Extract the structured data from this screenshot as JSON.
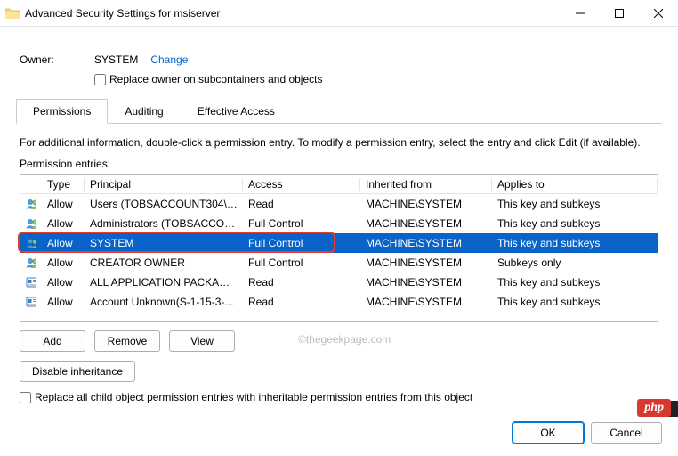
{
  "title": "Advanced Security Settings for msiserver",
  "owner": {
    "label": "Owner:",
    "value": "SYSTEM",
    "change": "Change",
    "replace_label": "Replace owner on subcontainers and objects"
  },
  "tabs": [
    "Permissions",
    "Auditing",
    "Effective Access"
  ],
  "intro": "For additional information, double-click a permission entry. To modify a permission entry, select the entry and click Edit (if available).",
  "entries_label": "Permission entries:",
  "columns": {
    "type": "Type",
    "principal": "Principal",
    "access": "Access",
    "inherited": "Inherited from",
    "applies": "Applies to"
  },
  "rows": [
    {
      "icon": "users",
      "type": "Allow",
      "principal": "Users (TOBSACCOUNT304\\Us...",
      "access": "Read",
      "inherited": "MACHINE\\SYSTEM",
      "applies": "This key and subkeys",
      "selected": false
    },
    {
      "icon": "users",
      "type": "Allow",
      "principal": "Administrators (TOBSACCOU...",
      "access": "Full Control",
      "inherited": "MACHINE\\SYSTEM",
      "applies": "This key and subkeys",
      "selected": false
    },
    {
      "icon": "users",
      "type": "Allow",
      "principal": "SYSTEM",
      "access": "Full Control",
      "inherited": "MACHINE\\SYSTEM",
      "applies": "This key and subkeys",
      "selected": true
    },
    {
      "icon": "users",
      "type": "Allow",
      "principal": "CREATOR OWNER",
      "access": "Full Control",
      "inherited": "MACHINE\\SYSTEM",
      "applies": "Subkeys only",
      "selected": false
    },
    {
      "icon": "card",
      "type": "Allow",
      "principal": "ALL APPLICATION PACKAGES",
      "access": "Read",
      "inherited": "MACHINE\\SYSTEM",
      "applies": "This key and subkeys",
      "selected": false
    },
    {
      "icon": "card",
      "type": "Allow",
      "principal": "Account Unknown(S-1-15-3-...",
      "access": "Read",
      "inherited": "MACHINE\\SYSTEM",
      "applies": "This key and subkeys",
      "selected": false
    }
  ],
  "buttons": {
    "add": "Add",
    "remove": "Remove",
    "view": "View",
    "disable": "Disable inheritance",
    "ok": "OK",
    "cancel": "Cancel"
  },
  "replace_all": "Replace all child object permission entries with inheritable permission entries from this object",
  "watermark": "©thegeekpage.com",
  "php": "php"
}
